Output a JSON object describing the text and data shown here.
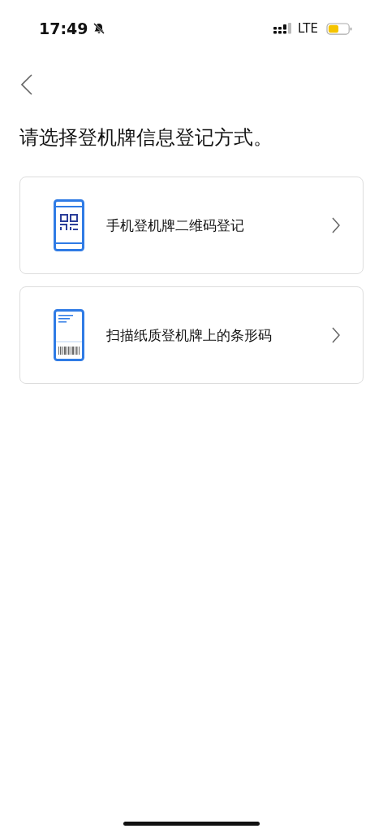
{
  "status_bar": {
    "time": "17:49",
    "network": "LTE"
  },
  "title": "请选择登机牌信息登记方式。",
  "options": [
    {
      "kind": "qr",
      "label": "手机登机牌二维码登记"
    },
    {
      "kind": "barcode",
      "label": "扫描纸质登机牌上的条形码"
    }
  ]
}
